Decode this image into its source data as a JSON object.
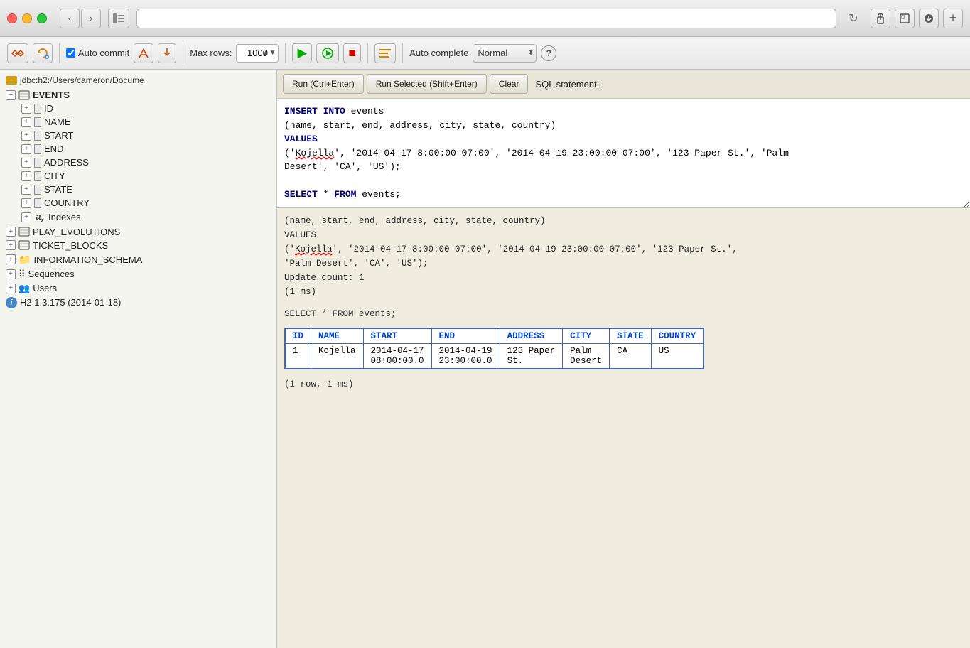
{
  "titlebar": {
    "url": "",
    "reload_label": "↻"
  },
  "toolbar": {
    "auto_commit_label": "Auto commit",
    "max_rows_label": "Max rows:",
    "max_rows_value": "1000",
    "auto_complete_label": "Auto complete",
    "normal_label": "Normal",
    "help_label": "?"
  },
  "sidebar": {
    "db_path": "jdbc:h2:/Users/cameron/Docume",
    "tables": [
      {
        "name": "EVENTS",
        "expanded": true,
        "columns": [
          "ID",
          "NAME",
          "START",
          "END",
          "ADDRESS",
          "CITY",
          "STATE",
          "COUNTRY"
        ],
        "has_indexes": true
      },
      {
        "name": "PLAY_EVOLUTIONS",
        "expanded": false
      },
      {
        "name": "TICKET_BLOCKS",
        "expanded": false
      },
      {
        "name": "INFORMATION_SCHEMA",
        "expanded": false,
        "is_folder": true
      }
    ],
    "sequences_label": "Sequences",
    "users_label": "Users",
    "version_label": "H2 1.3.175 (2014-01-18)",
    "indexes_label": "Indexes"
  },
  "sql_editor": {
    "run_label": "Run (Ctrl+Enter)",
    "run_selected_label": "Run Selected (Shift+Enter)",
    "clear_label": "Clear",
    "statement_label": "SQL statement:",
    "content": "INSERT INTO events\n(name, start, end, address, city, state, country)\nVALUES\n('Kojella', '2014-04-17 8:00:00-07:00', '2014-04-19 23:00:00-07:00', '123 Paper St.', 'Palm\nDesert', 'CA', 'US');\n\nSELECT * FROM events;"
  },
  "results": {
    "echo_text": "(name, start, end, address, city, state, country)\nVALUES\n('Kojella', '2014-04-17 8:00:00-07:00', '2014-04-19 23:00:00-07:00', '123 Paper St.',\n'Palm Desert', 'CA', 'US');\nUpdate count: 1\n(1 ms)",
    "select_statement": "SELECT * FROM events;",
    "table": {
      "headers": [
        "ID",
        "NAME",
        "START",
        "END",
        "ADDRESS",
        "CITY",
        "STATE",
        "COUNTRY"
      ],
      "rows": [
        [
          "1",
          "Kojella",
          "2014-04-17\n08:00:00.0",
          "2014-04-19\n23:00:00.0",
          "123 Paper\nSt.",
          "Palm\nDesert",
          "CA",
          "US"
        ]
      ]
    },
    "footer": "(1 row, 1 ms)"
  }
}
